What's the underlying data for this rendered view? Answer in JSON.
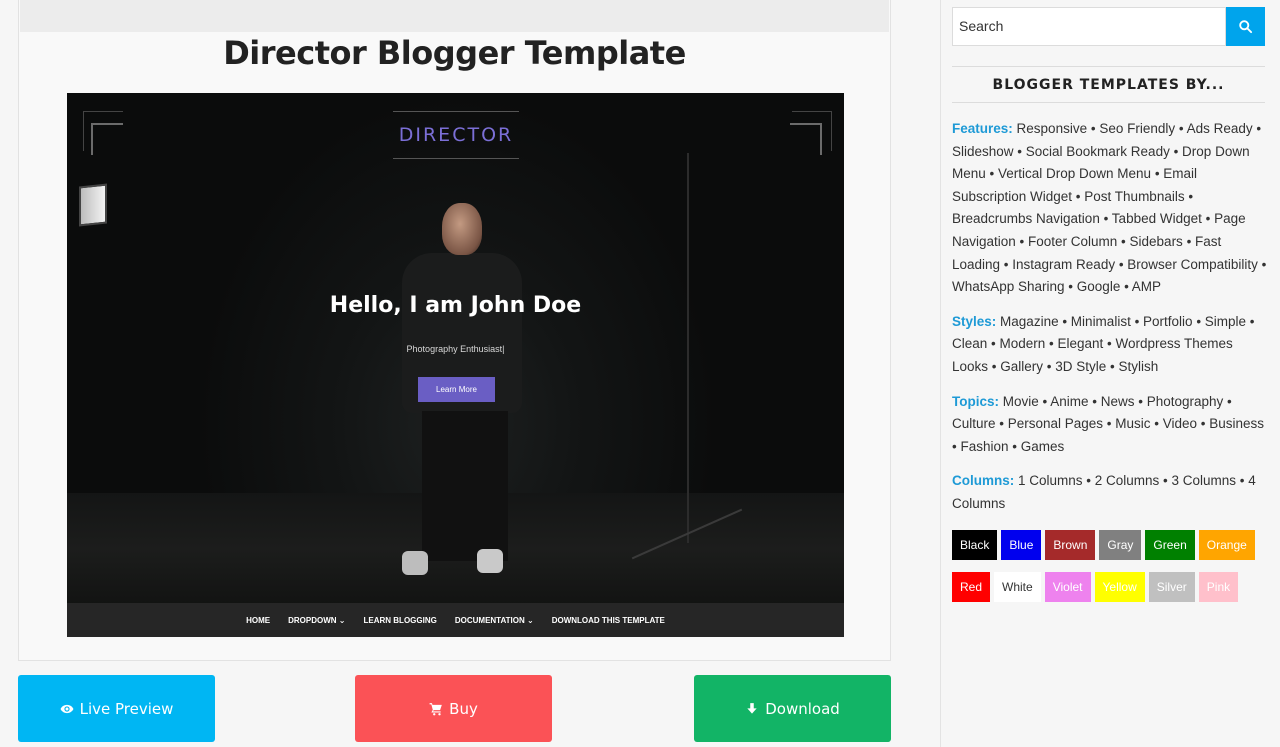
{
  "post": {
    "title": "Director Blogger Template"
  },
  "preview": {
    "logo": "DIRECTOR",
    "hero_title": "Hello, I am John Doe",
    "hero_subtitle": "Photography Enthusiast|",
    "hero_button": "Learn More",
    "nav": [
      "HOME",
      "DROPDOWN ⌄",
      "LEARN BLOGGING",
      "DOCUMENTATION ⌄",
      "DOWNLOAD THIS TEMPLATE"
    ]
  },
  "actions": {
    "live_preview": "Live Preview",
    "buy": "Buy",
    "download": "Download",
    "colors": {
      "live": "#00b6f3",
      "buy": "#fb5256",
      "download": "#12b466"
    }
  },
  "sidebar": {
    "search_placeholder": "Search",
    "heading": "BLOGGER TEMPLATES BY...",
    "features_label": "Features:",
    "features_text": "Responsive • Seo Friendly • Ads Ready • Slideshow • Social Bookmark Ready • Drop Down Menu • Vertical Drop Down Menu • Email Subscription Widget • Post Thumbnails • Breadcrumbs Navigation • Tabbed Widget • Page Navigation • Footer Column • Sidebars • Fast Loading • Instagram Ready • Browser Compatibility • WhatsApp Sharing • Google • AMP",
    "styles_label": "Styles:",
    "styles_text": "Magazine • Minimalist • Portfolio • Simple • Clean • Modern • Elegant • Wordpress Themes Looks • Gallery • 3D Style • Stylish",
    "topics_label": "Topics:",
    "topics_text": "Movie • Anime • News • Photography • Culture • Personal Pages • Music • Video • Business • Fashion • Games",
    "columns_label": "Columns:",
    "columns_text": "1 Columns • 2 Columns • 3 Columns • 4 Columns",
    "color_rows": [
      [
        {
          "label": "Black",
          "bg": "#000000",
          "fg": "#ffffff"
        },
        {
          "label": "Blue",
          "bg": "#0000ee",
          "fg": "#ffffff"
        },
        {
          "label": "Brown",
          "bg": "#a52a2a",
          "fg": "#ffffff"
        },
        {
          "label": "Gray",
          "bg": "#808080",
          "fg": "#ffffff"
        },
        {
          "label": "Green",
          "bg": "#008000",
          "fg": "#ffffff"
        },
        {
          "label": "Orange",
          "bg": "#ffa500",
          "fg": "#ffffff"
        }
      ],
      [
        {
          "label": "Red",
          "bg": "#ff0000",
          "fg": "#ffffff"
        },
        {
          "label": "White",
          "bg": "#ffffff",
          "fg": "#333333"
        },
        {
          "label": "Violet",
          "bg": "#ee82ee",
          "fg": "#ffffff"
        },
        {
          "label": "Yellow",
          "bg": "#ffff00",
          "fg": "#ffffff"
        },
        {
          "label": "Silver",
          "bg": "#c0c0c0",
          "fg": "#ffffff"
        },
        {
          "label": "Pink",
          "bg": "#ffc0cb",
          "fg": "#ffffff"
        }
      ]
    ]
  }
}
